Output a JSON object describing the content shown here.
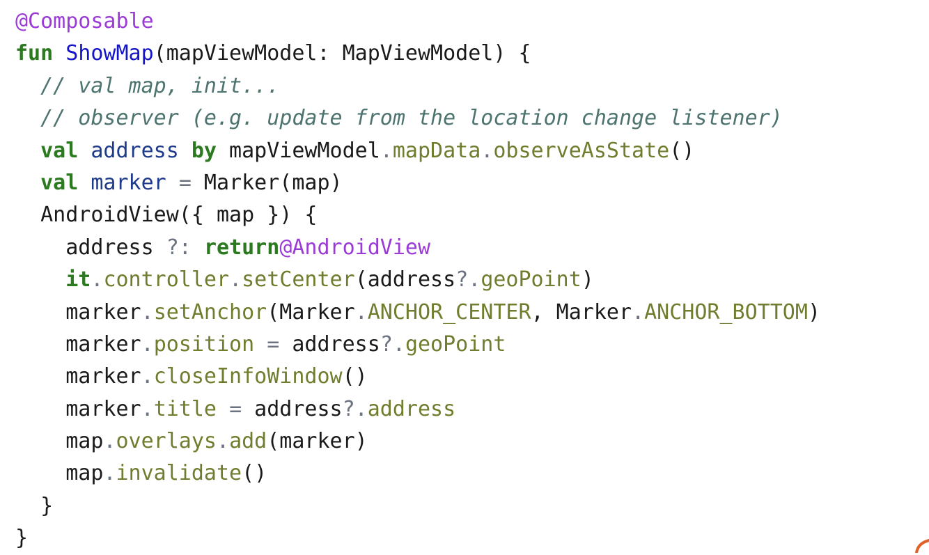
{
  "lines": [
    [
      {
        "t": "annot",
        "v": "@Composable"
      }
    ],
    [
      {
        "t": "kw",
        "v": "fun"
      },
      {
        "t": "plain",
        "v": " "
      },
      {
        "t": "fn",
        "v": "ShowMap"
      },
      {
        "t": "plain",
        "v": "(mapViewModel: MapViewModel) {"
      }
    ],
    [
      {
        "t": "plain",
        "v": "  "
      },
      {
        "t": "comment",
        "v": "// val map, init..."
      }
    ],
    [
      {
        "t": "plain",
        "v": "  "
      },
      {
        "t": "comment",
        "v": "// observer (e.g. update from the location change listener)"
      }
    ],
    [
      {
        "t": "plain",
        "v": "  "
      },
      {
        "t": "kw",
        "v": "val"
      },
      {
        "t": "plain",
        "v": " "
      },
      {
        "t": "var",
        "v": "address"
      },
      {
        "t": "plain",
        "v": " "
      },
      {
        "t": "kw",
        "v": "by"
      },
      {
        "t": "plain",
        "v": " mapViewModel"
      },
      {
        "t": "op",
        "v": "."
      },
      {
        "t": "member",
        "v": "mapData"
      },
      {
        "t": "op",
        "v": "."
      },
      {
        "t": "member",
        "v": "observeAsState"
      },
      {
        "t": "plain",
        "v": "()"
      }
    ],
    [
      {
        "t": "plain",
        "v": "  "
      },
      {
        "t": "kw",
        "v": "val"
      },
      {
        "t": "plain",
        "v": " "
      },
      {
        "t": "var",
        "v": "marker"
      },
      {
        "t": "plain",
        "v": " "
      },
      {
        "t": "op",
        "v": "="
      },
      {
        "t": "plain",
        "v": " Marker(map)"
      }
    ],
    [
      {
        "t": "plain",
        "v": "  AndroidView({ map }) {"
      }
    ],
    [
      {
        "t": "plain",
        "v": "    address "
      },
      {
        "t": "op",
        "v": "?:"
      },
      {
        "t": "plain",
        "v": " "
      },
      {
        "t": "kw",
        "v": "return"
      },
      {
        "t": "annot",
        "v": "@AndroidView"
      }
    ],
    [
      {
        "t": "plain",
        "v": "    "
      },
      {
        "t": "kw",
        "v": "it"
      },
      {
        "t": "op",
        "v": "."
      },
      {
        "t": "member",
        "v": "controller"
      },
      {
        "t": "op",
        "v": "."
      },
      {
        "t": "member",
        "v": "setCenter"
      },
      {
        "t": "plain",
        "v": "(address"
      },
      {
        "t": "op",
        "v": "?."
      },
      {
        "t": "member",
        "v": "geoPoint"
      },
      {
        "t": "plain",
        "v": ")"
      }
    ],
    [
      {
        "t": "plain",
        "v": "    marker"
      },
      {
        "t": "op",
        "v": "."
      },
      {
        "t": "member",
        "v": "setAnchor"
      },
      {
        "t": "plain",
        "v": "(Marker"
      },
      {
        "t": "op",
        "v": "."
      },
      {
        "t": "member",
        "v": "ANCHOR_CENTER"
      },
      {
        "t": "plain",
        "v": ", Marker"
      },
      {
        "t": "op",
        "v": "."
      },
      {
        "t": "member",
        "v": "ANCHOR_BOTTOM"
      },
      {
        "t": "plain",
        "v": ")"
      }
    ],
    [
      {
        "t": "plain",
        "v": "    marker"
      },
      {
        "t": "op",
        "v": "."
      },
      {
        "t": "member",
        "v": "position"
      },
      {
        "t": "plain",
        "v": " "
      },
      {
        "t": "op",
        "v": "="
      },
      {
        "t": "plain",
        "v": " address"
      },
      {
        "t": "op",
        "v": "?."
      },
      {
        "t": "member",
        "v": "geoPoint"
      }
    ],
    [
      {
        "t": "plain",
        "v": "    marker"
      },
      {
        "t": "op",
        "v": "."
      },
      {
        "t": "member",
        "v": "closeInfoWindow"
      },
      {
        "t": "plain",
        "v": "()"
      }
    ],
    [
      {
        "t": "plain",
        "v": "    marker"
      },
      {
        "t": "op",
        "v": "."
      },
      {
        "t": "member",
        "v": "title"
      },
      {
        "t": "plain",
        "v": " "
      },
      {
        "t": "op",
        "v": "="
      },
      {
        "t": "plain",
        "v": " address"
      },
      {
        "t": "op",
        "v": "?."
      },
      {
        "t": "member",
        "v": "address"
      }
    ],
    [
      {
        "t": "plain",
        "v": "    map"
      },
      {
        "t": "op",
        "v": "."
      },
      {
        "t": "member",
        "v": "overlays"
      },
      {
        "t": "op",
        "v": "."
      },
      {
        "t": "member",
        "v": "add"
      },
      {
        "t": "plain",
        "v": "(marker)"
      }
    ],
    [
      {
        "t": "plain",
        "v": "    map"
      },
      {
        "t": "op",
        "v": "."
      },
      {
        "t": "member",
        "v": "invalidate"
      },
      {
        "t": "plain",
        "v": "()"
      }
    ],
    [
      {
        "t": "plain",
        "v": "  }"
      }
    ],
    [
      {
        "t": "plain",
        "v": "}"
      }
    ]
  ],
  "colors": {
    "annotation": "#9b3bd6",
    "keyword": "#2c7a1f",
    "function": "#1414c8",
    "variable": "#1e3a8a",
    "member": "#6e7d2e",
    "operator": "#6b7280",
    "comment": "#4e7470",
    "text": "#1a1a1a",
    "corner_mark": "#e0612a"
  }
}
